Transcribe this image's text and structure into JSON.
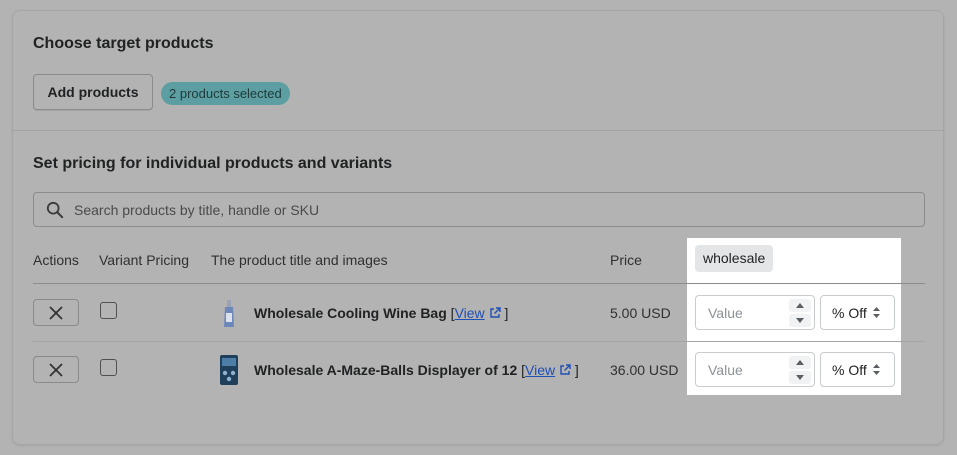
{
  "section1": {
    "title": "Choose target products",
    "add_button": "Add products",
    "badge": "2 products selected"
  },
  "section2": {
    "title": "Set pricing for individual products and variants",
    "search": {
      "placeholder": "Search products by title, handle or SKU",
      "value": ""
    }
  },
  "table": {
    "headers": {
      "actions": "Actions",
      "variant_pricing": "Variant Pricing",
      "product": "The product title and images",
      "price": "Price",
      "tag": "wholesale"
    },
    "rows": [
      {
        "title": "Wholesale Cooling Wine Bag",
        "link_open": "[",
        "link": "View",
        "link_close": "]",
        "price": "5.00 USD",
        "value_placeholder": "Value",
        "discount_type": "% Off",
        "variant_pricing_checked": false
      },
      {
        "title": "Wholesale A-Maze-Balls Displayer of 12",
        "link_open": "[",
        "link": "View",
        "link_close": "]",
        "price": "36.00 USD",
        "value_placeholder": "Value",
        "discount_type": "% Off",
        "variant_pricing_checked": false
      }
    ]
  },
  "icons": {
    "search": "search-icon",
    "remove": "close-icon",
    "external": "external-link-icon",
    "select": "select-arrows-icon",
    "stepper_up": "caret-up-icon",
    "stepper_down": "caret-down-icon"
  },
  "colors": {
    "overlay": "#b3b3b3",
    "badge": "#5c9ea1",
    "link": "#1f4fb5",
    "highlight": "#ffffff",
    "tag_bg": "#e4e5e7"
  }
}
